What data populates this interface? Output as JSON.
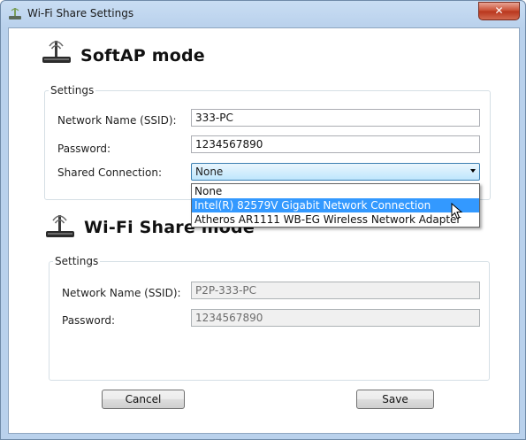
{
  "window": {
    "title": "Wi-Fi Share Settings",
    "close_label": "✕"
  },
  "softap": {
    "heading": "SoftAP mode",
    "group_label": "Settings",
    "ssid_label": "Network Name (SSID):",
    "ssid_value": "333-PC",
    "password_label": "Password:",
    "password_value": "1234567890",
    "shared_label": "Shared Connection:",
    "shared_value": "None",
    "dropdown_options": [
      "None",
      "Intel(R) 82579V Gigabit Network Connection",
      "Atheros AR1111 WB-EG Wireless Network Adapter"
    ],
    "highlighted_option": "Intel(R) 82579V Gigabit Network Connection"
  },
  "wifishare": {
    "heading": "Wi-Fi Share mode",
    "group_label": "Settings",
    "ssid_label": "Network Name (SSID):",
    "ssid_value": "P2P-333-PC",
    "password_label": "Password:",
    "password_value": "1234567890"
  },
  "buttons": {
    "cancel": "Cancel",
    "save": "Save"
  },
  "icons": {
    "title": "wifi-router-icon",
    "section": "wifi-router-icon",
    "close": "close-icon",
    "cursor": "mouse-pointer-icon"
  },
  "colors": {
    "highlight": "#3399ff",
    "combo_border": "#3c7fb1",
    "close_red": "#c74a2f"
  }
}
